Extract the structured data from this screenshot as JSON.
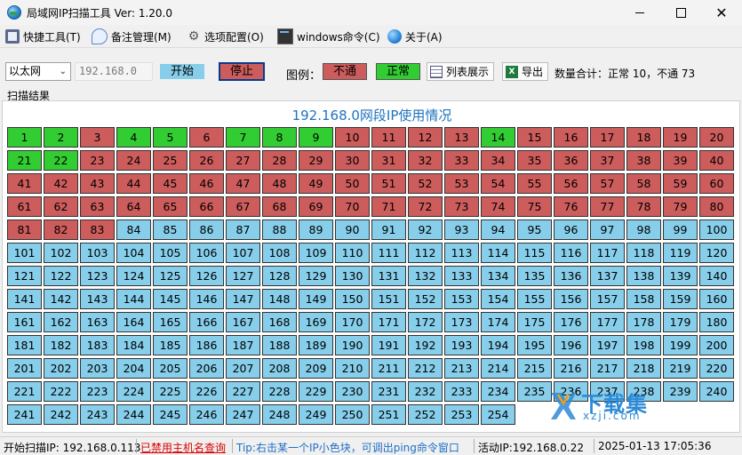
{
  "window": {
    "title": "局域网IP扫描工具  Ver: 1.20.0",
    "minimize": "",
    "maximize": "",
    "close": "✕"
  },
  "menu": {
    "items": [
      {
        "label": "快捷工具(T)",
        "icon": "tools-icon"
      },
      {
        "label": "备注管理(M)",
        "icon": "note-icon"
      },
      {
        "label": "选项配置(O)",
        "icon": "gear-icon"
      },
      {
        "label": "windows命令(C)",
        "icon": "console-icon"
      },
      {
        "label": "关于(A)",
        "icon": "globe-icon"
      }
    ]
  },
  "toolbar": {
    "adapter": "以太网",
    "ip_prefix": "192.168.0",
    "start_label": "开始",
    "stop_label": "停止",
    "legend_label": "图例：",
    "legend_bad": "不通",
    "legend_ok": "正常",
    "list_label": "列表展示",
    "export_label": "导出",
    "summary": "数量合计：正常 10，不通 73"
  },
  "scan": {
    "group_label": "扫描结果",
    "title": "192.168.0网段IP使用情况",
    "ok_ips": [
      1,
      2,
      4,
      5,
      7,
      8,
      9,
      14,
      21,
      22
    ],
    "bad_max": 83,
    "max": 254,
    "columns": 20
  },
  "watermark": {
    "text": "下载集",
    "sub": "xzji.com"
  },
  "status": {
    "start_ip": "开始扫描IP: 192.168.0.113",
    "hostname": "已禁用主机名查询",
    "tip": "Tip:右击某一个IP小色块，可调出ping命令窗口",
    "active_ip": "活动IP:192.168.0.22",
    "datetime": "2025-01-13  17:05:36"
  },
  "colors": {
    "ok": "#32cd32",
    "bad": "#cd5c5c",
    "free": "#87ceeb",
    "title_blue": "#1e73be"
  }
}
